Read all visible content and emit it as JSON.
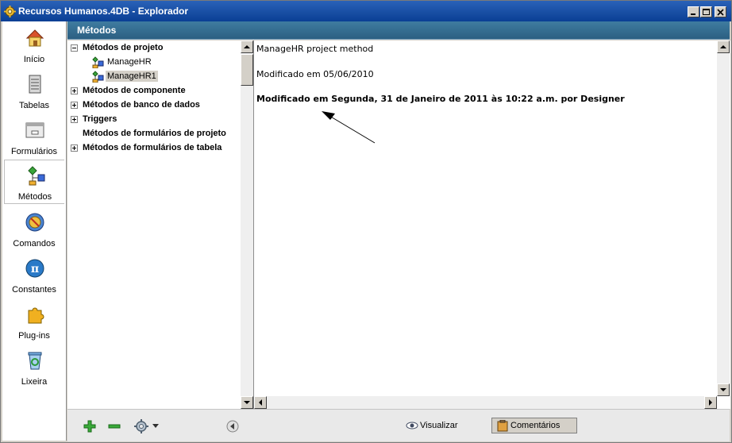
{
  "window": {
    "title": "Recursos Humanos.4DB - Explorador"
  },
  "sidebar": {
    "items": [
      {
        "label": "Início",
        "icon": "home-icon"
      },
      {
        "label": "Tabelas",
        "icon": "table-icon"
      },
      {
        "label": "Formulários",
        "icon": "form-icon"
      },
      {
        "label": "Métodos",
        "icon": "method-icon",
        "active": true
      },
      {
        "label": "Comandos",
        "icon": "command-icon"
      },
      {
        "label": "Constantes",
        "icon": "pi-icon"
      },
      {
        "label": "Plug-ins",
        "icon": "puzzle-icon"
      },
      {
        "label": "Lixeira",
        "icon": "trash-icon"
      }
    ]
  },
  "header": {
    "title": "Métodos"
  },
  "tree": {
    "items": [
      {
        "label": "Métodos de projeto",
        "bold": true,
        "expander": "minus"
      },
      {
        "label": "ManageHR",
        "bold": false,
        "child": true
      },
      {
        "label": "ManageHR1",
        "bold": false,
        "child": true,
        "selected": true
      },
      {
        "label": "Métodos de componente",
        "bold": true,
        "expander": "plus"
      },
      {
        "label": "Métodos de banco de dados",
        "bold": true,
        "expander": "plus"
      },
      {
        "label": "Triggers",
        "bold": true,
        "expander": "plus"
      },
      {
        "label": "Métodos de formulários de projeto",
        "bold": true,
        "expander": "none"
      },
      {
        "label": "Métodos de formulários de tabela",
        "bold": true,
        "expander": "plus"
      }
    ]
  },
  "editor": {
    "lines": [
      "ManageHR project method",
      "Modificado em 05/06/2010",
      "Modificado em Segunda, 31 de Janeiro de 2011 às 10:22 a.m. por Designer"
    ]
  },
  "toolbar": {
    "view_label": "Visualizar",
    "comments_label": "Comentários"
  },
  "colors": {
    "titlebar": "#0a3f94",
    "header": "#2b5f82",
    "selection": "#d4d0c8"
  }
}
